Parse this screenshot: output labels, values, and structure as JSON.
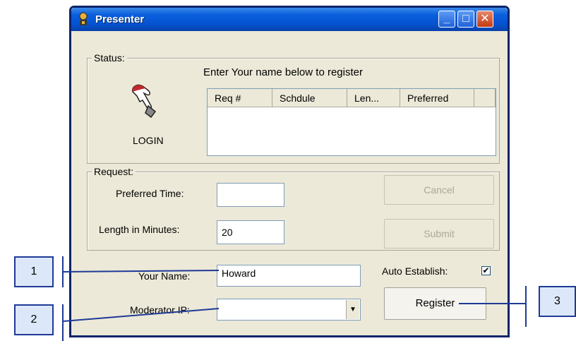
{
  "window": {
    "title": "Presenter"
  },
  "status": {
    "label": "Status:",
    "prompt": "Enter Your name below to register",
    "login_label": "LOGIN",
    "columns": [
      "Req #",
      "Schdule",
      "Len...",
      "Preferred"
    ]
  },
  "request": {
    "label": "Request:",
    "preferred_time_label": "Preferred Time:",
    "preferred_time_value": "",
    "length_label": "Length in Minutes:",
    "length_value": "20",
    "cancel_label": "Cancel",
    "submit_label": "Submit"
  },
  "form": {
    "name_label": "Your Name:",
    "name_value": "Howard",
    "moderator_label": "Moderator IP:",
    "moderator_value": "",
    "auto_establish_label": "Auto Establish:",
    "auto_establish_checked": true,
    "register_label": "Register"
  },
  "callouts": {
    "one": "1",
    "two": "2",
    "three": "3"
  },
  "colors": {
    "callout_fill": "#dce8fa",
    "callout_line": "#1e3a96",
    "titlebar": "#0553d0"
  }
}
